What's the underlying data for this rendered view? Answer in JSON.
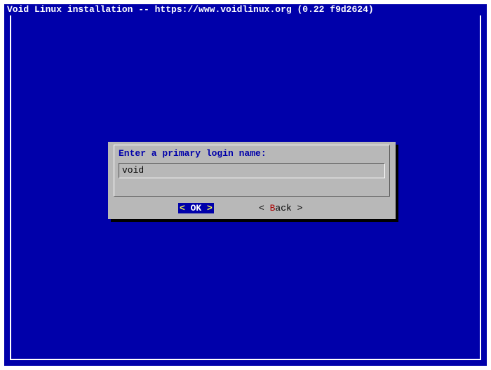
{
  "title": "Void Linux installation -- https://www.voidlinux.org (0.22 f9d2624)",
  "dialog": {
    "prompt": "Enter a primary login name:",
    "input_value": "void"
  },
  "buttons": {
    "ok_left": "<",
    "ok_label": " OK ",
    "ok_right": ">",
    "back_left": "< ",
    "back_hot": "B",
    "back_rest": "ack ",
    "back_right": ">"
  }
}
